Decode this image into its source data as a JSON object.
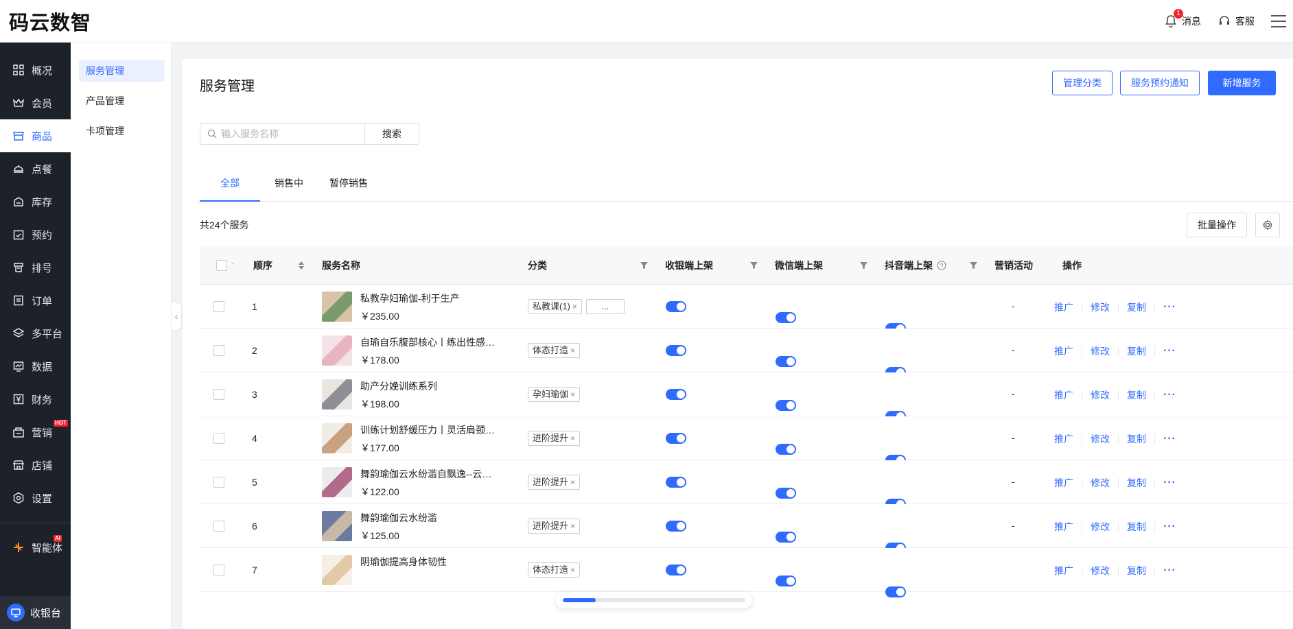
{
  "app": {
    "logo": "码云数智",
    "notification_label": "消息",
    "notification_count": "1",
    "service_label": "客服"
  },
  "sidebar": {
    "items": [
      {
        "label": "概况",
        "icon": "grid-icon"
      },
      {
        "label": "会员",
        "icon": "crown-icon"
      },
      {
        "label": "商品",
        "icon": "store-icon",
        "active": true
      },
      {
        "label": "点餐",
        "icon": "dish-icon"
      },
      {
        "label": "库存",
        "icon": "inventory-icon"
      },
      {
        "label": "预约",
        "icon": "calendar-check-icon"
      },
      {
        "label": "排号",
        "icon": "queue-icon"
      },
      {
        "label": "订单",
        "icon": "order-icon"
      },
      {
        "label": "多平台",
        "icon": "layers-icon"
      },
      {
        "label": "数据",
        "icon": "chart-icon"
      },
      {
        "label": "财务",
        "icon": "finance-icon"
      },
      {
        "label": "营销",
        "icon": "marketing-icon",
        "badge": "HOT"
      },
      {
        "label": "店铺",
        "icon": "shop-icon"
      },
      {
        "label": "设置",
        "icon": "settings-icon"
      }
    ],
    "ai_label": "智能体",
    "ai_badge": "AI",
    "cashier_label": "收银台"
  },
  "subnav": {
    "items": [
      {
        "label": "服务管理",
        "active": true
      },
      {
        "label": "产品管理"
      },
      {
        "label": "卡项管理"
      }
    ]
  },
  "main": {
    "title": "服务管理",
    "buttons": {
      "manage_category": "管理分类",
      "appointment_notice": "服务预约通知",
      "add_service": "新增服务"
    },
    "search": {
      "placeholder": "输入服务名称",
      "button": "搜索"
    },
    "tabs": [
      "全部",
      "销售中",
      "暂停销售"
    ],
    "count_text": "共24个服务",
    "batch_label": "批量操作"
  },
  "table": {
    "columns": {
      "order": "顺序",
      "name": "服务名称",
      "category": "分类",
      "pos": "收银端上架",
      "wechat": "微信端上架",
      "douyin": "抖音端上架",
      "marketing": "营销活动",
      "ops": "操作"
    },
    "op_labels": {
      "promote": "推广",
      "edit": "修改",
      "copy": "复制",
      "more": "···"
    },
    "rows": [
      {
        "order": "1",
        "name": "私教孕妇瑜伽-利于生产",
        "price": "￥235.00",
        "tags": [
          "私教课(1)"
        ],
        "more_tag": "...",
        "marketing": "-",
        "pos_on": true,
        "wechat_on": true,
        "douyin_on": true
      },
      {
        "order": "2",
        "name": "自瑜自乐腹部核心丨练出性感马甲线",
        "price": "￥178.00",
        "tags": [
          "体态打造"
        ],
        "marketing": "-",
        "pos_on": true,
        "wechat_on": true,
        "douyin_on": true
      },
      {
        "order": "3",
        "name": "助产分娩训练系列",
        "price": "￥198.00",
        "tags": [
          "孕妇瑜伽"
        ],
        "marketing": "-",
        "pos_on": true,
        "wechat_on": true,
        "douyin_on": true
      },
      {
        "order": "4",
        "name": "训练计划舒缓压力丨灵活肩颈理疗",
        "price": "￥177.00",
        "tags": [
          "进阶提升"
        ],
        "marketing": "-",
        "pos_on": true,
        "wechat_on": true,
        "douyin_on": true
      },
      {
        "order": "5",
        "name": "舞韵瑜伽云水纷滥自飘逸--云水逸",
        "price": "￥122.00",
        "tags": [
          "进阶提升"
        ],
        "marketing": "-",
        "pos_on": true,
        "wechat_on": true,
        "douyin_on": true
      },
      {
        "order": "6",
        "name": "舞韵瑜伽云水纷滥",
        "price": "￥125.00",
        "tags": [
          "进阶提升"
        ],
        "marketing": "-",
        "pos_on": true,
        "wechat_on": true,
        "douyin_on": true
      },
      {
        "order": "7",
        "name": "阴瑜伽提高身体韧性",
        "price": "",
        "tags": [
          "体态打造"
        ],
        "marketing": "",
        "pos_on": true,
        "wechat_on": true,
        "douyin_on": true
      }
    ]
  },
  "progress": {
    "fraction": 0.18
  },
  "colors": {
    "accent": "#2f6bff",
    "sidebar_bg": "#1d2129"
  }
}
